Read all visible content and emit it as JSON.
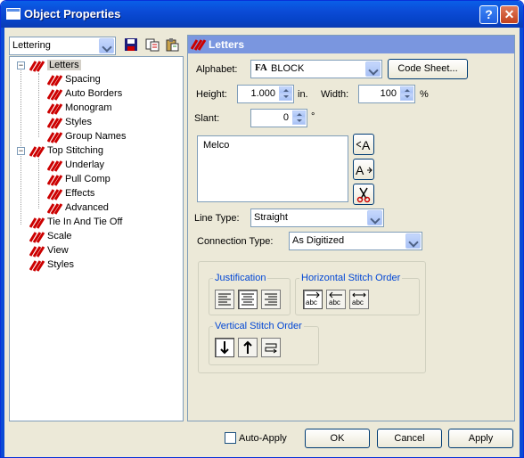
{
  "window": {
    "title": "Object Properties",
    "help_label": "?",
    "close_label": "✕"
  },
  "left": {
    "category_select": "Lettering",
    "tree": [
      {
        "label": "Letters",
        "level": 0,
        "expander": "−",
        "selected": true
      },
      {
        "label": "Spacing",
        "level": 1
      },
      {
        "label": "Auto Borders",
        "level": 1
      },
      {
        "label": "Monogram",
        "level": 1
      },
      {
        "label": "Styles",
        "level": 1
      },
      {
        "label": "Group Names",
        "level": 1
      },
      {
        "label": "Top Stitching",
        "level": 0,
        "expander": "−"
      },
      {
        "label": "Underlay",
        "level": 1
      },
      {
        "label": "Pull Comp",
        "level": 1
      },
      {
        "label": "Effects",
        "level": 1
      },
      {
        "label": "Advanced",
        "level": 1
      },
      {
        "label": "Tie In And Tie Off",
        "level": 0
      },
      {
        "label": "Scale",
        "level": 0
      },
      {
        "label": "View",
        "level": 0
      },
      {
        "label": "Styles",
        "level": 0
      }
    ]
  },
  "right": {
    "header": "Letters",
    "alphabet_label": "Alphabet:",
    "alphabet_value": "BLOCK",
    "alphabet_prefix": "FA",
    "code_sheet_label": "Code Sheet...",
    "height_label": "Height:",
    "height_value": "1.000",
    "height_unit": "in.",
    "width_label": "Width:",
    "width_value": "100",
    "width_unit": "%",
    "slant_label": "Slant:",
    "slant_value": "0",
    "slant_unit": "°",
    "text_value": "Melco",
    "line_type_label": "Line Type:",
    "line_type_value": "Straight",
    "connection_type_label": "Connection Type:",
    "connection_type_value": "As Digitized",
    "justification_title": "Justification",
    "horizontal_order_title": "Horizontal Stitch Order",
    "vertical_order_title": "Vertical Stitch Order",
    "horizontal_btn_text": [
      "abc",
      "abc",
      "abc"
    ]
  },
  "footer": {
    "auto_apply_label": "Auto-Apply",
    "ok_label": "OK",
    "cancel_label": "Cancel",
    "apply_label": "Apply"
  },
  "colors": {
    "title_bar": "#0b4bd6",
    "panel_header": "#7a96df",
    "lettering_icon": "#cc0000",
    "group_title": "#0046d5"
  }
}
